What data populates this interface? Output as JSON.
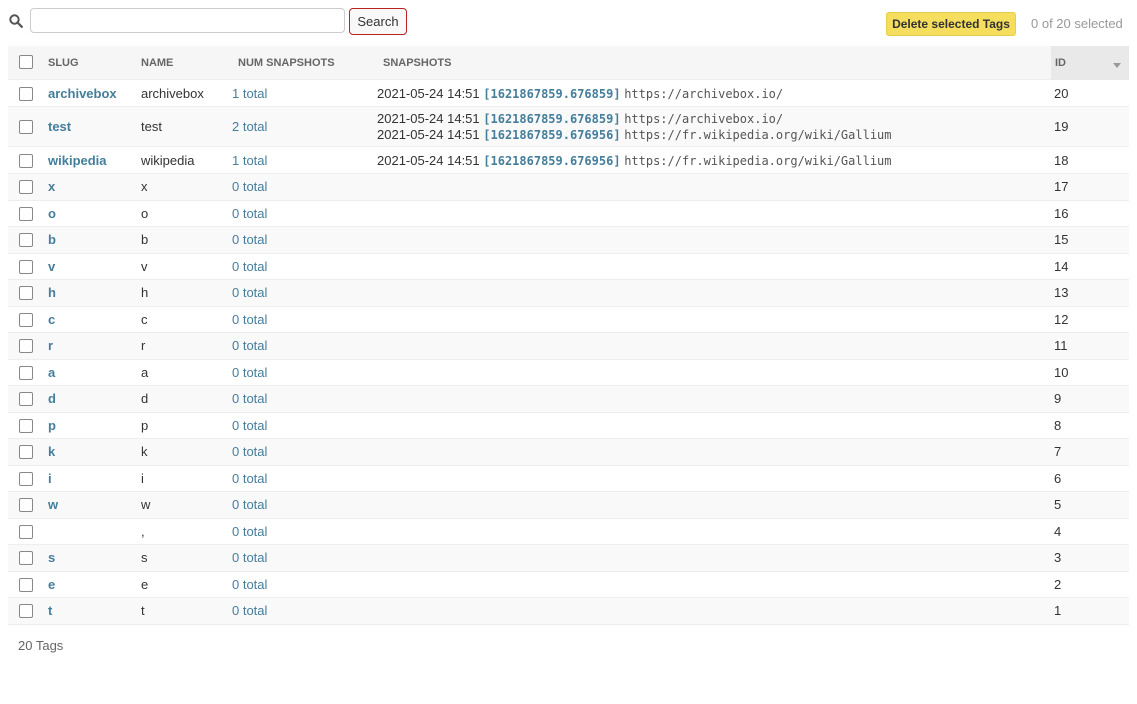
{
  "toolbar": {
    "search_placeholder": "",
    "search_value": "",
    "search_label": "Search",
    "delete_label": "Delete selected Tags",
    "selected_text": "0 of 20 selected"
  },
  "table": {
    "headers": {
      "slug": "SLUG",
      "name": "NAME",
      "num": "NUM SNAPSHOTS",
      "snapshots": "SNAPSHOTS",
      "id": "ID"
    },
    "rows": [
      {
        "slug": "archivebox",
        "name": "archivebox",
        "num": "1 total",
        "id": "20",
        "snapshots": [
          {
            "ts": "2021-05-24 14:51",
            "sid": "[1621867859.676859]",
            "url": "https://archivebox.io/"
          }
        ]
      },
      {
        "slug": "test",
        "name": "test",
        "num": "2 total",
        "id": "19",
        "snapshots": [
          {
            "ts": "2021-05-24 14:51",
            "sid": "[1621867859.676859]",
            "url": "https://archivebox.io/"
          },
          {
            "ts": "2021-05-24 14:51",
            "sid": "[1621867859.676956]",
            "url": "https://fr.wikipedia.org/wiki/Gallium"
          }
        ]
      },
      {
        "slug": "wikipedia",
        "name": "wikipedia",
        "num": "1 total",
        "id": "18",
        "snapshots": [
          {
            "ts": "2021-05-24 14:51",
            "sid": "[1621867859.676956]",
            "url": "https://fr.wikipedia.org/wiki/Gallium"
          }
        ]
      },
      {
        "slug": "x",
        "name": "x",
        "num": "0 total",
        "id": "17",
        "snapshots": []
      },
      {
        "slug": "o",
        "name": "o",
        "num": "0 total",
        "id": "16",
        "snapshots": []
      },
      {
        "slug": "b",
        "name": "b",
        "num": "0 total",
        "id": "15",
        "snapshots": []
      },
      {
        "slug": "v",
        "name": "v",
        "num": "0 total",
        "id": "14",
        "snapshots": []
      },
      {
        "slug": "h",
        "name": "h",
        "num": "0 total",
        "id": "13",
        "snapshots": []
      },
      {
        "slug": "c",
        "name": "c",
        "num": "0 total",
        "id": "12",
        "snapshots": []
      },
      {
        "slug": "r",
        "name": "r",
        "num": "0 total",
        "id": "11",
        "snapshots": []
      },
      {
        "slug": "a",
        "name": "a",
        "num": "0 total",
        "id": "10",
        "snapshots": []
      },
      {
        "slug": "d",
        "name": "d",
        "num": "0 total",
        "id": "9",
        "snapshots": []
      },
      {
        "slug": "p",
        "name": "p",
        "num": "0 total",
        "id": "8",
        "snapshots": []
      },
      {
        "slug": "k",
        "name": "k",
        "num": "0 total",
        "id": "7",
        "snapshots": []
      },
      {
        "slug": "i",
        "name": "i",
        "num": "0 total",
        "id": "6",
        "snapshots": []
      },
      {
        "slug": "w",
        "name": "w",
        "num": "0 total",
        "id": "5",
        "snapshots": []
      },
      {
        "slug": "",
        "name": ",",
        "num": "0 total",
        "id": "4",
        "snapshots": []
      },
      {
        "slug": "s",
        "name": "s",
        "num": "0 total",
        "id": "3",
        "snapshots": []
      },
      {
        "slug": "e",
        "name": "e",
        "num": "0 total",
        "id": "2",
        "snapshots": []
      },
      {
        "slug": "t",
        "name": "t",
        "num": "0 total",
        "id": "1",
        "snapshots": []
      }
    ]
  },
  "footer": {
    "count_text": "20 Tags"
  },
  "colors": {
    "link": "#447e9b",
    "delete_button": "#f5dd5d",
    "search_border": "#ba2121"
  },
  "icons": {
    "search": "search-icon",
    "sort": "sort-desc-icon"
  }
}
